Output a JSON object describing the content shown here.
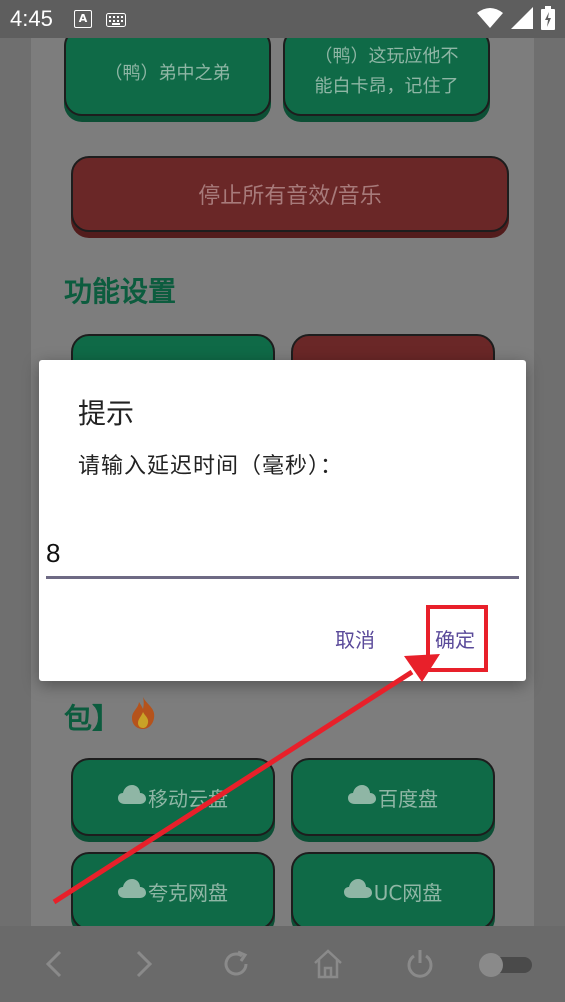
{
  "status_bar": {
    "time": "4:45",
    "icons": [
      "a-notification-icon",
      "keyboard-icon",
      "wifi-icon",
      "signal-icon",
      "battery-icon"
    ]
  },
  "buttons_top": {
    "left_label": "（鸭）弟中之弟",
    "right_label_line1": "（鸭）这玩应他不",
    "right_label_line2": "能白卡昂，记住了"
  },
  "stop_button": {
    "label": "停止所有音效/音乐"
  },
  "section": {
    "title": "功能设置"
  },
  "dialog": {
    "title": "提示",
    "message": "请输入延迟时间（毫秒）：",
    "input_value": "8",
    "cancel_label": "取消",
    "confirm_label": "确定"
  },
  "below_dialog": {
    "partial_title": "包】"
  },
  "cloud_buttons": [
    {
      "label": "移动云盘"
    },
    {
      "label": "百度盘"
    },
    {
      "label": "夸克网盘"
    },
    {
      "label": "UC网盘"
    }
  ],
  "colors": {
    "green_button": "#0f6a47",
    "red_button": "#6a2727",
    "accent_text": "#5a4a9a",
    "annotation_red": "#e8202a"
  }
}
